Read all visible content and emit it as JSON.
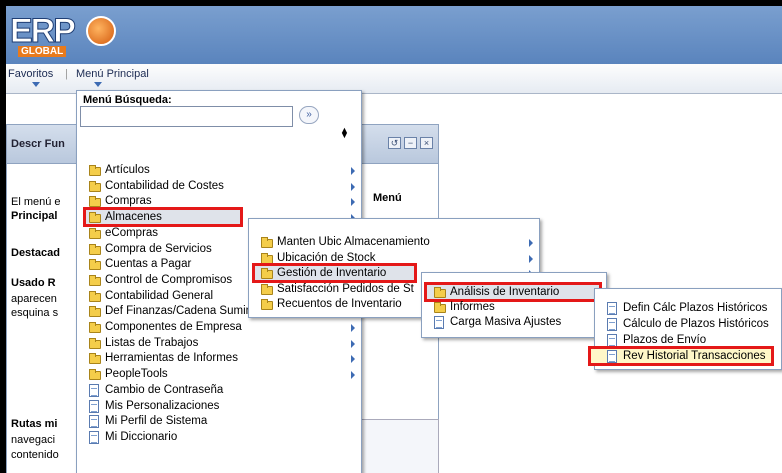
{
  "app": {
    "logo_text": "ERP",
    "logo_sub": "GLOBAL"
  },
  "nav": {
    "favoritos": "Favoritos",
    "menu_principal": "Menú Principal",
    "separator": "|"
  },
  "pagelet": {
    "title": "Descr Fun",
    "lines": [
      "El menú e",
      "Principal",
      "Destacad",
      "Usado R",
      "aparecen",
      "esquina s",
      "Rutas mi",
      "navegaci",
      "contenido"
    ],
    "right_text": "Menú"
  },
  "controls": {
    "c1": "↺",
    "c2": "−",
    "c3": "×"
  },
  "search": {
    "label": "Menú Búsqueda:",
    "value": "",
    "go": "»"
  },
  "menu1": {
    "items": [
      {
        "label": "Artículos",
        "type": "folder",
        "arrow": true
      },
      {
        "label": "Contabilidad de Costes",
        "type": "folder",
        "arrow": true
      },
      {
        "label": "Compras",
        "type": "folder",
        "arrow": true
      },
      {
        "label": "Almacenes",
        "type": "folder",
        "arrow": true,
        "highlight": true
      },
      {
        "label": "eCompras",
        "type": "folder",
        "arrow": true
      },
      {
        "label": "Compra de Servicios",
        "type": "folder",
        "arrow": true
      },
      {
        "label": "Cuentas a Pagar",
        "type": "folder",
        "arrow": true
      },
      {
        "label": "Control de Compromisos",
        "type": "folder",
        "arrow": true
      },
      {
        "label": "Contabilidad General",
        "type": "folder",
        "arrow": true
      },
      {
        "label": "Def Finanzas/Cadena Suministro",
        "type": "folder",
        "arrow": true
      },
      {
        "label": "Componentes de Empresa",
        "type": "folder",
        "arrow": true
      },
      {
        "label": "Listas de Trabajos",
        "type": "folder",
        "arrow": true
      },
      {
        "label": "Herramientas de Informes",
        "type": "folder",
        "arrow": true
      },
      {
        "label": "PeopleTools",
        "type": "folder",
        "arrow": true
      },
      {
        "label": "Cambio de Contraseña",
        "type": "doc",
        "arrow": false
      },
      {
        "label": "Mis Personalizaciones",
        "type": "doc",
        "arrow": false
      },
      {
        "label": "Mi Perfil de Sistema",
        "type": "doc",
        "arrow": false
      },
      {
        "label": "Mi Diccionario",
        "type": "doc",
        "arrow": false
      }
    ]
  },
  "menu2": {
    "items": [
      {
        "label": "Manten Ubic Almacenamiento",
        "type": "folder",
        "arrow": true
      },
      {
        "label": "Ubicación de Stock",
        "type": "folder",
        "arrow": true
      },
      {
        "label": "Gestión de Inventario",
        "type": "folder",
        "arrow": true,
        "highlight": true
      },
      {
        "label": "Satisfacción Pedidos de St",
        "type": "folder",
        "arrow": true
      },
      {
        "label": "Recuentos de Inventario",
        "type": "folder",
        "arrow": true
      }
    ]
  },
  "menu3": {
    "items": [
      {
        "label": "Análisis de Inventario",
        "type": "folder",
        "arrow": false,
        "highlight": true
      },
      {
        "label": "Informes",
        "type": "folder",
        "arrow": false
      },
      {
        "label": "Carga Masiva Ajustes",
        "type": "doc",
        "arrow": false
      }
    ]
  },
  "menu4": {
    "items": [
      {
        "label": "Defin Cálc Plazos Históricos",
        "type": "doc"
      },
      {
        "label": "Cálculo de Plazos Históricos",
        "type": "doc"
      },
      {
        "label": "Plazos de Envío",
        "type": "doc"
      },
      {
        "label": "Rev Historial Transacciones",
        "type": "doc",
        "highlight": true
      }
    ]
  },
  "colors": {
    "highlight_border": "#e41818",
    "header_blue": "#5a84bd",
    "folder_yellow": "#f4cd4a"
  }
}
